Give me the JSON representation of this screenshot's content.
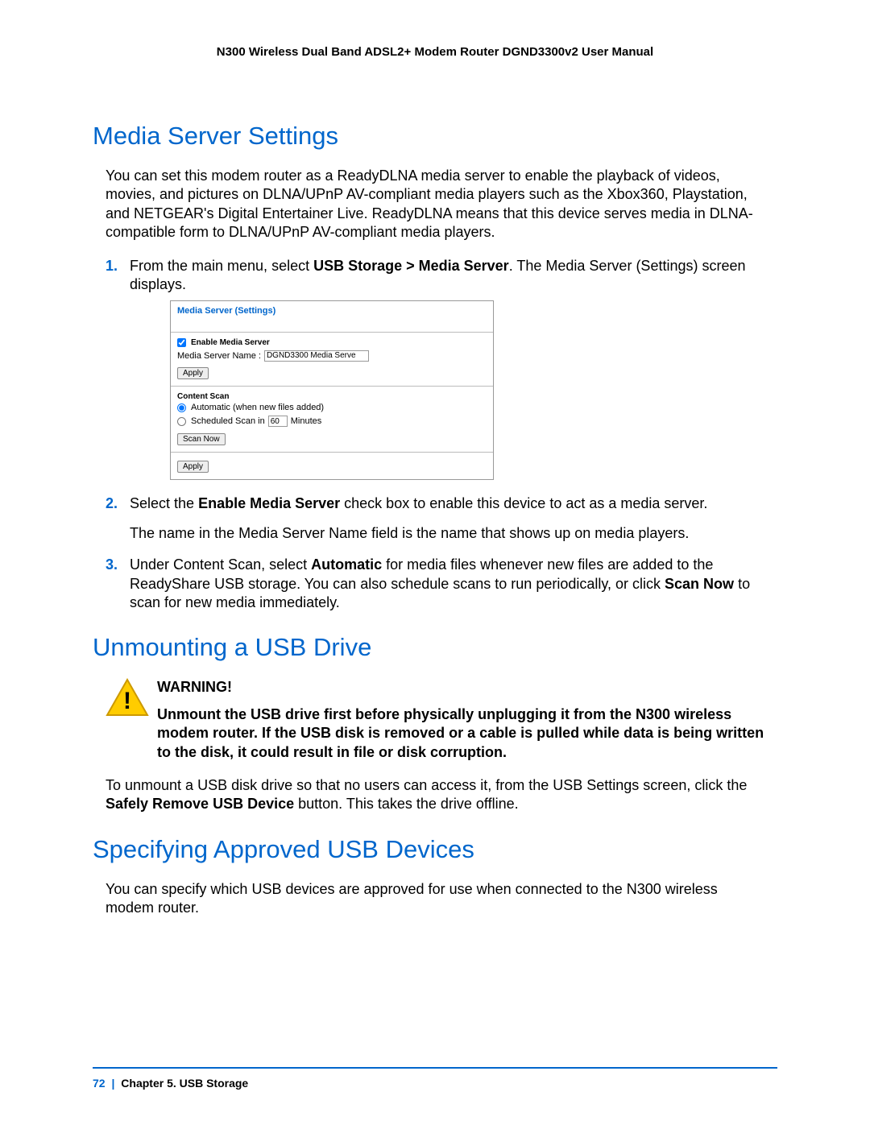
{
  "header": {
    "running_title": "N300 Wireless Dual Band ADSL2+ Modem Router DGND3300v2 User Manual"
  },
  "sections": {
    "media": {
      "title": "Media Server Settings",
      "intro": "You can set this modem router as a ReadyDLNA media server to enable the playback of videos, movies, and pictures on DLNA/UPnP AV-compliant media players such as the Xbox360, Playstation, and NETGEAR's Digital Entertainer Live. ReadyDLNA means that this device serves media in DLNA-compatible form to DLNA/UPnP AV-compliant media players.",
      "step1_pre": "From the main menu, select ",
      "step1_bold": "USB Storage > Media Server",
      "step1_post": ". The Media Server (Settings) screen displays.",
      "step2_pre": "Select the ",
      "step2_bold": "Enable Media Server",
      "step2_post": " check box to enable this device to act as a media server.",
      "step2_sub": "The name in the Media Server Name field is the name that shows up on media players.",
      "step3_pre": "Under Content Scan, select ",
      "step3_bold1": "Automatic",
      "step3_mid": " for media files whenever new files are added to the ReadyShare USB storage. You can also schedule scans to run periodically, or click ",
      "step3_bold2": "Scan Now",
      "step3_post": " to scan for new media immediately."
    },
    "unmount": {
      "title": "Unmounting a USB Drive",
      "warning_title": "WARNING!",
      "warning_body": "Unmount the USB drive first before physically unplugging it from the N300 wireless modem router. If the USB disk is removed or a cable is pulled while data is being written to the disk, it could result in file or disk corruption.",
      "after_pre": "To unmount a USB disk drive so that no users can access it, from the USB Settings screen, click the ",
      "after_bold": "Safely Remove USB Device",
      "after_post": " button. This takes the drive offline."
    },
    "approved": {
      "title": "Specifying Approved USB Devices",
      "intro": "You can specify which USB devices are approved for use when connected to the N300 wireless modem router."
    }
  },
  "ui_panel": {
    "title": "Media Server (Settings)",
    "enable_label": "Enable Media Server",
    "name_label": "Media Server Name :",
    "name_value": "DGND3300 Media Serve",
    "apply": "Apply",
    "section2_title": "Content Scan",
    "auto_label": "Automatic (when new files added)",
    "sched_label_pre": "Scheduled Scan in",
    "sched_value": "60",
    "sched_label_post": "Minutes",
    "scan_now": "Scan Now"
  },
  "footer": {
    "page": "72",
    "chapter": "Chapter 5.  USB Storage"
  }
}
